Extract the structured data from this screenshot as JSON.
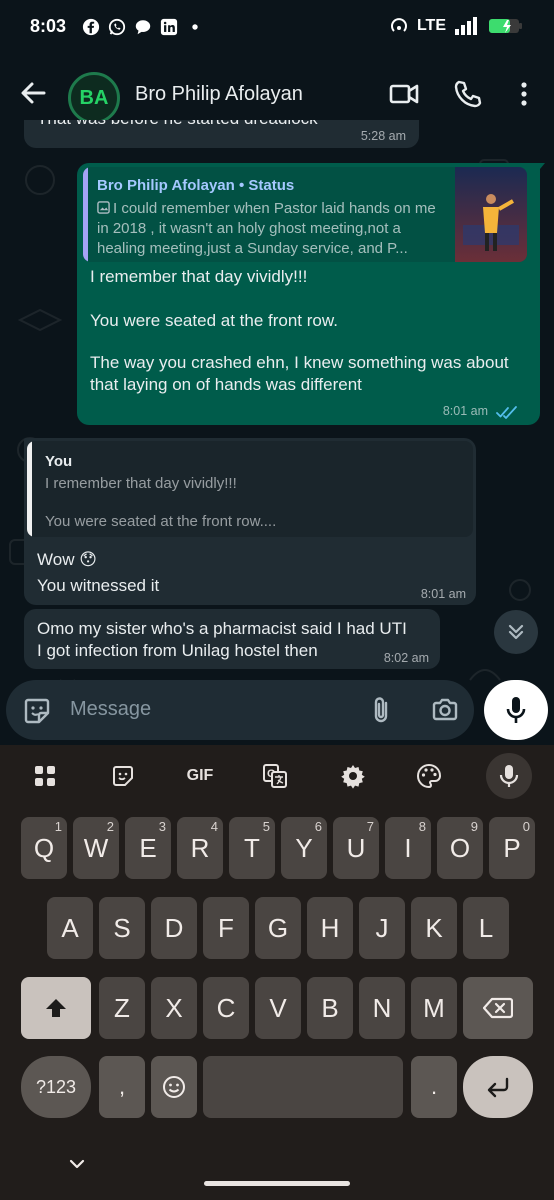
{
  "status_bar": {
    "time": "8:03",
    "network": "LTE",
    "notification_icons": [
      "facebook-icon",
      "whatsapp-icon",
      "chat-icon",
      "linkedin-icon",
      "dot-icon"
    ]
  },
  "header": {
    "avatar_initials": "BA",
    "contact_name": "Bro Philip Afolayan"
  },
  "messages": {
    "m0": {
      "text": "That was before he started dreadlock",
      "time": "5:28 am"
    },
    "m1": {
      "reply_author": "Bro Philip Afolayan • Status",
      "reply_text": "I could remember when Pastor laid hands on me in 2018 , it wasn't an holy ghost meeting,not a healing meeting,just a Sunday service, and P...",
      "line1": "I remember that day vividly!!!",
      "line2": "You were seated at the front row.",
      "line3": "The way you crashed ehn, I knew something was about that laying on of hands was different",
      "time": "8:01 am"
    },
    "m2": {
      "reply_author": "You",
      "reply_line1": "I remember that day vividly!!!",
      "reply_line2": "You were seated at the front row....",
      "line1": "Wow 😯",
      "line2": "You witnessed it",
      "time": "8:01 am"
    },
    "m3": {
      "line1": "Omo my sister who's a pharmacist said I had UTI",
      "line2": "I got infection from Unilag hostel then",
      "time": "8:02 am"
    }
  },
  "composer": {
    "placeholder": "Message"
  },
  "keyboard": {
    "row1": [
      {
        "k": "Q",
        "h": "1"
      },
      {
        "k": "W",
        "h": "2"
      },
      {
        "k": "E",
        "h": "3"
      },
      {
        "k": "R",
        "h": "4"
      },
      {
        "k": "T",
        "h": "5"
      },
      {
        "k": "Y",
        "h": "6"
      },
      {
        "k": "U",
        "h": "7"
      },
      {
        "k": "I",
        "h": "8"
      },
      {
        "k": "O",
        "h": "9"
      },
      {
        "k": "P",
        "h": "0"
      }
    ],
    "row2": [
      "A",
      "S",
      "D",
      "F",
      "G",
      "H",
      "J",
      "K",
      "L"
    ],
    "row3": [
      "Z",
      "X",
      "C",
      "V",
      "B",
      "N",
      "M"
    ],
    "symbols_label": "?123",
    "comma_label": ",",
    "period_label": ".",
    "gif_label": "GIF"
  },
  "colors": {
    "outgoing_bubble": "#005c4b",
    "incoming_bubble": "#202c33",
    "accent": "#25d366",
    "read_ticks": "#53bdeb"
  }
}
